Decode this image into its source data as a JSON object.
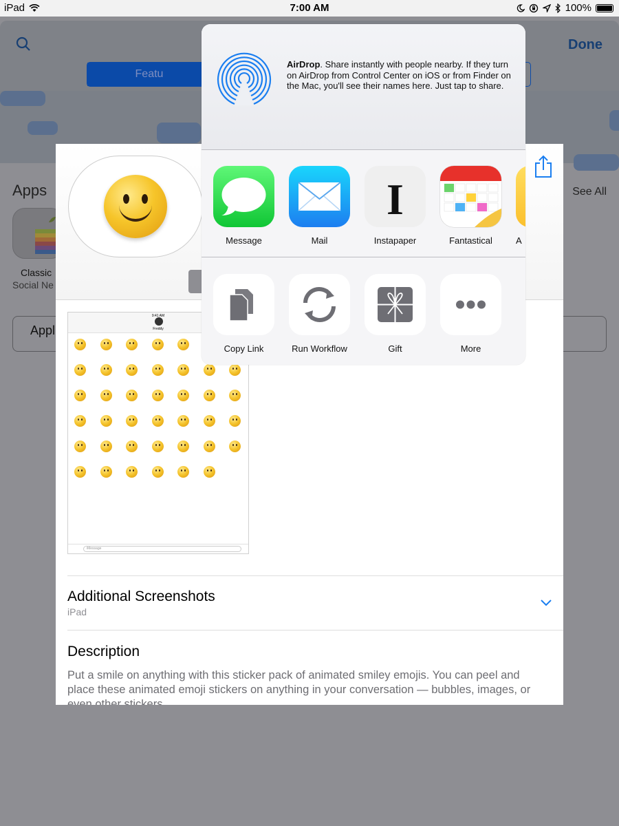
{
  "status_bar": {
    "device": "iPad",
    "time": "7:00 AM",
    "battery": "100%"
  },
  "background_store": {
    "done_label": "Done",
    "segment_label": "Featu",
    "apps_title": "Apps",
    "see_all": "See All",
    "app_name": "Classic",
    "app_sub": "Social Ne",
    "button_label": "Appl"
  },
  "detail": {
    "screenshot": {
      "time": "9:41 AM",
      "contact": "Freddy",
      "message_placeholder": "iMessage"
    },
    "additional_screenshots_title": "Additional Screenshots",
    "additional_screenshots_sub": "iPad",
    "description_title": "Description",
    "description_text": "Put a smile on anything with this sticker pack of animated smiley emojis. You can peel and place these animated emoji stickers on anything in your conversation — bubbles, images, or even other stickers."
  },
  "share_sheet": {
    "airdrop_title": "AirDrop",
    "airdrop_text": ". Share instantly with people nearby. If they turn on AirDrop from Control Center on iOS or from Finder on the Mac, you'll see their names here. Just tap to share.",
    "apps": [
      {
        "label": "Message",
        "icon": "messages-icon"
      },
      {
        "label": "Mail",
        "icon": "mail-icon"
      },
      {
        "label": "Instapaper",
        "icon": "instapaper-icon"
      },
      {
        "label": "Fantastical",
        "icon": "fantastical-icon"
      },
      {
        "label": "A",
        "icon": "notes-icon"
      }
    ],
    "actions": [
      {
        "label": "Copy Link",
        "icon": "copy-link-icon"
      },
      {
        "label": "Run Workflow",
        "icon": "workflow-icon"
      },
      {
        "label": "Gift",
        "icon": "gift-icon"
      },
      {
        "label": "More",
        "icon": "more-icon"
      }
    ]
  },
  "colors": {
    "ios_blue": "#1a7ef0",
    "dim_background": "#8e8e93",
    "sheet_background": "#f5f5f7"
  }
}
